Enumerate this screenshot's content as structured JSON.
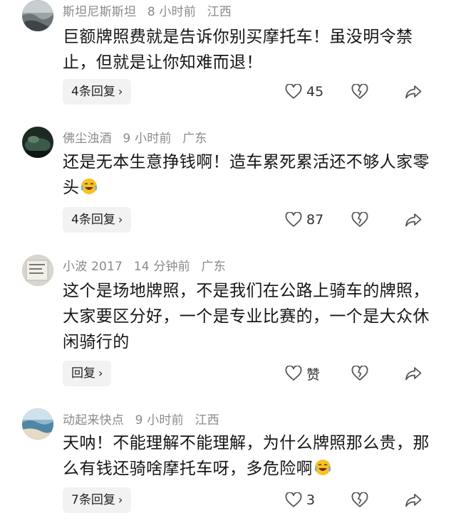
{
  "comments": [
    {
      "username": "斯坦尼斯斯坦",
      "time": "8 小时前",
      "location": "江西",
      "text": "巨额牌照费就是告诉你别买摩托车！虽没明令禁止，但就是让你知难而退！",
      "reply_label": "4条回复",
      "like_count": "45"
    },
    {
      "username": "佛尘浊酒",
      "time": "9 小时前",
      "location": "广东",
      "text": "还是无本生意挣钱啊！造车累死累活还不够人家零头",
      "emoji": "laughing-tears-emoji",
      "reply_label": "4条回复",
      "like_count": "87"
    },
    {
      "username": "小波 2017",
      "time": "14 分钟前",
      "location": "广东",
      "text": "这个是场地牌照，不是我们在公路上骑车的牌照，大家要区分好，一个是专业比赛的，一个是大众休闲骑行的",
      "reply_label": "回复",
      "like_count": "赞"
    },
    {
      "username": "动起来快点",
      "time": "9 小时前",
      "location": "江西",
      "text": "天呐！不能理解不能理解，为什么牌照那么贵，那么有钱还骑啥摩托车呀，多危险啊",
      "emoji": "laughing-tears-emoji",
      "reply_label": "7条回复",
      "like_count": "3"
    }
  ],
  "icons": {
    "like": "heart-icon",
    "dislike": "broken-heart-icon",
    "share": "share-arrow-icon",
    "chevron": "chevron-right-icon"
  },
  "colors": {
    "text": "#161616",
    "meta": "#8a8a8a",
    "pill_bg": "#f2f2f2",
    "icon": "#555555"
  }
}
